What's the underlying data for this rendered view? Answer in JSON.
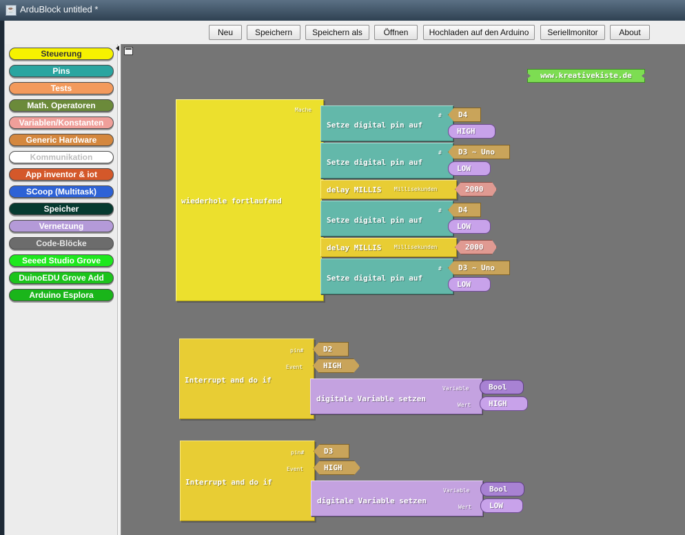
{
  "window": {
    "title": "ArduBlock untitled *",
    "icon": "java-icon"
  },
  "toolbar": {
    "buttons": [
      "Neu",
      "Speichern",
      "Speichern als",
      "Öffnen",
      "Hochladen auf den Arduino",
      "Seriellmonitor",
      "About"
    ]
  },
  "palette": {
    "categories": [
      {
        "label": "Steuerung",
        "bg": "#f6f200",
        "fg": "#333333"
      },
      {
        "label": "Pins",
        "bg": "#2aa5a0",
        "fg": "#ffffff"
      },
      {
        "label": "Tests",
        "bg": "#f39a5c",
        "fg": "#ffffff"
      },
      {
        "label": "Math. Operatoren",
        "bg": "#6b8a3a",
        "fg": "#ffffff"
      },
      {
        "label": "Variablen/Konstanten",
        "bg": "#ef9f9a",
        "fg": "#ffffff"
      },
      {
        "label": "Generic Hardware",
        "bg": "#d4873e",
        "fg": "#ffffff"
      },
      {
        "label": "Kommunikation",
        "bg": "#ffffff",
        "fg": "#bdbdbd"
      },
      {
        "label": "App inventor & iot",
        "bg": "#d4582a",
        "fg": "#ffffff"
      },
      {
        "label": "SCoop (Multitask)",
        "bg": "#2d62d6",
        "fg": "#ffffff"
      },
      {
        "label": "Speicher",
        "bg": "#053a30",
        "fg": "#ffffff"
      },
      {
        "label": "Vernetzung",
        "bg": "#b49ad8",
        "fg": "#ffffff"
      },
      {
        "label": "Code-Blöcke",
        "bg": "#6c6c6c",
        "fg": "#e6e6e6"
      },
      {
        "label": "Seeed Studio Grove",
        "bg": "#1ee81e",
        "fg": "#ffffff"
      },
      {
        "label": "DuinoEDU Grove Add",
        "bg": "#1cc41c",
        "fg": "#ffffff"
      },
      {
        "label": "Arduino Esplora",
        "bg": "#1ab51a",
        "fg": "#ffffff"
      }
    ]
  },
  "canvas": {
    "watermark": "www.kreativekiste.de",
    "loop": {
      "label": "wiederhole fortlaufend",
      "socket_label": "Mache",
      "statements": [
        {
          "kind": "pin",
          "label": "Setze digital pin auf",
          "hash": "#",
          "pin": "D4",
          "value": "HIGH"
        },
        {
          "kind": "pin",
          "label": "Setze digital pin auf",
          "hash": "#",
          "pin": "D3 ~ Uno",
          "value": "LOW"
        },
        {
          "kind": "delay",
          "label": "delay MILLIS",
          "param": "Millisekunden",
          "value": "2000"
        },
        {
          "kind": "pin",
          "label": "Setze digital pin auf",
          "hash": "#",
          "pin": "D4",
          "value": "LOW"
        },
        {
          "kind": "delay",
          "label": "delay MILLIS",
          "param": "Millisekunden",
          "value": "2000"
        },
        {
          "kind": "pin",
          "label": "Setze digital pin auf",
          "hash": "#",
          "pin": "D3 ~ Uno",
          "value": "LOW"
        }
      ]
    },
    "interrupts": [
      {
        "label": "Interrupt and do if",
        "pin_label": "pin#",
        "pin": "D2",
        "event_label": "Event",
        "event": "HIGH",
        "action": {
          "label": "digitale Variable setzen",
          "var_label": "Variable",
          "var": "Bool",
          "val_label": "Wert",
          "val": "HIGH"
        }
      },
      {
        "label": "Interrupt and do if",
        "pin_label": "pin#",
        "pin": "D3",
        "event_label": "Event",
        "event": "HIGH",
        "action": {
          "label": "digitale Variable setzen",
          "var_label": "Variable",
          "var": "Bool",
          "val_label": "Wert",
          "val": "LOW"
        }
      }
    ]
  }
}
